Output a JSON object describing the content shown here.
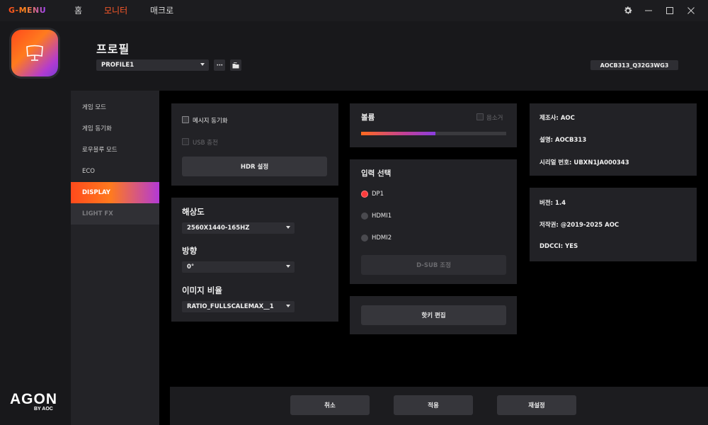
{
  "app": {
    "brand": "G-MENU"
  },
  "nav": {
    "home": "홈",
    "monitor": "모니터",
    "macro": "매크로"
  },
  "colors": {
    "accent_start": "#ff4a1c",
    "accent_mid": "#ff7a1e",
    "accent_end": "#a242ff",
    "radio_on": "#ff3b3b"
  },
  "header": {
    "title": "프로필",
    "profile_value": "PROFILE1",
    "more_label": "•••",
    "model": "AOCB313_Q32G3WG3"
  },
  "sidebar": {
    "items": [
      {
        "label": "게임 모드"
      },
      {
        "label": "게임 동기화"
      },
      {
        "label": "로우블루 모드"
      },
      {
        "label": "ECO"
      },
      {
        "label": "DISPLAY"
      },
      {
        "label": "LIGHT FX"
      }
    ],
    "brand_logo": "AGON",
    "brand_sub": "BY AOC"
  },
  "display_panel": {
    "message_sync": "메시지 동기화",
    "usb_charge": "USB 충전",
    "hdr_button": "HDR 설정"
  },
  "settings_panel": {
    "resolution_label": "해상도",
    "resolution_value": "2560X1440-165HZ",
    "orientation_label": "방향",
    "orientation_value": "0°",
    "ratio_label": "이미지 비율",
    "ratio_value": "RATIO_FULLSCALEMAX__1"
  },
  "volume": {
    "label": "볼륨",
    "mute_label": "음소거",
    "level_percent": 51
  },
  "input": {
    "title": "입력 선택",
    "options": [
      "DP1",
      "HDMI1",
      "HDMI2"
    ],
    "selected": "DP1",
    "dsub_button": "D-SUB 조정"
  },
  "hotkey": {
    "button": "핫키 편집"
  },
  "device_info": {
    "manufacturer": "제조사: AOC",
    "description": "설명: AOCB313",
    "serial": "시리얼 번호: UBXN1JA000343"
  },
  "version_info": {
    "version": "버전: 1.4",
    "copyright": "저작권: @2019-2025 AOC",
    "ddcci": "DDCCI: YES"
  },
  "footer": {
    "cancel": "취소",
    "apply": "적용",
    "reset": "재설정"
  },
  "icons": {
    "settings": "gear-icon",
    "minimize": "minimize-icon",
    "maximize": "maximize-icon",
    "close": "close-icon",
    "app": "monitor-icon",
    "folder": "folder-icon"
  }
}
